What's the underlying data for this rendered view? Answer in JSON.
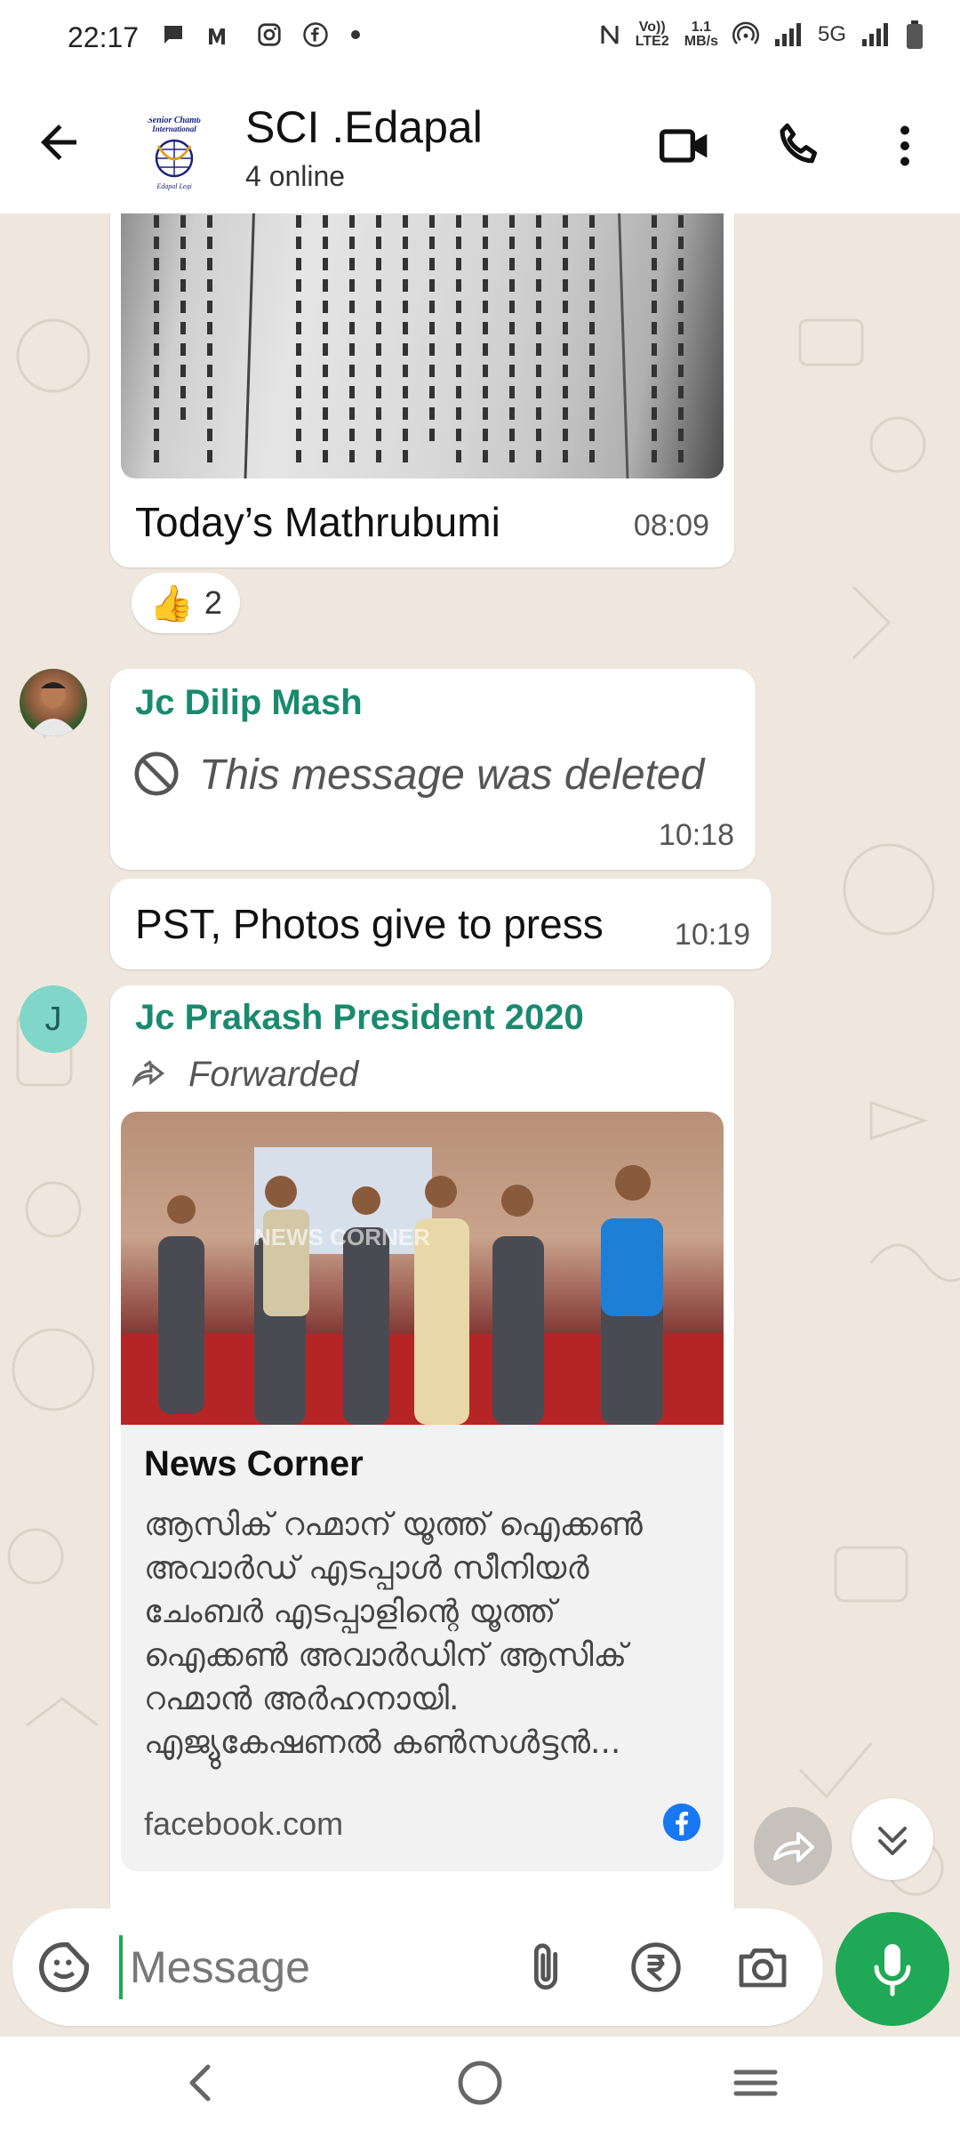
{
  "status_bar": {
    "time": "22:17",
    "network_speed_top": "1.1",
    "network_speed_unit": "MB/s",
    "volte": "Vo)) LTE2",
    "network_type": "5G"
  },
  "header": {
    "title": "SCI .Edapal",
    "status": "4 online",
    "avatar_text_top": "Senior Chamber International",
    "avatar_text_bottom": "Edapal Legion"
  },
  "messages": {
    "m1": {
      "caption": "Today’s Mathrubumi",
      "time": "08:09",
      "reaction_emoji": "👍",
      "reaction_count": "2"
    },
    "m2": {
      "sender": "Jc Dilip Mash",
      "text": "This message was deleted",
      "time": "10:18"
    },
    "m3": {
      "text": "PST, Photos give to press",
      "time": "10:19"
    },
    "m4": {
      "sender": "Jc Prakash President 2020",
      "sender_initial": "J",
      "forwarded_label": "Forwarded",
      "image_watermark": "NEWS CORNER",
      "preview_title": "News Corner",
      "preview_desc": "ആസിക് റഹ്മാന് യൂത്ത് ഐക്കൺ അവാർഡ് എടപ്പാൾ സീനിയർ ചേംബർ എടപ്പാളിന്റെ യൂത്ത് ഐക്കൺ അവാർഡിന് ആസിക് റഹ്മാൻ അർഹനായി. എജ്യുകേഷണൽ കൺസൾട്ടൻ...",
      "preview_domain": "facebook.com"
    }
  },
  "input": {
    "placeholder": "Message"
  },
  "colors": {
    "accent_green": "#1fa855",
    "sender_green": "#1a8a6e",
    "chat_bg": "#efe7dd"
  }
}
